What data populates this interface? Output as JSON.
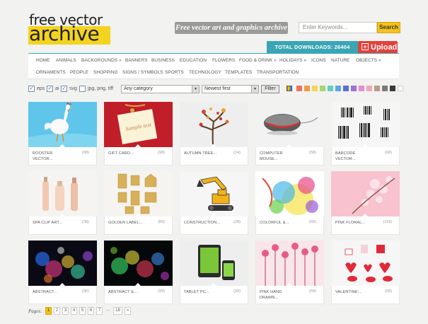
{
  "header": {
    "logo_line1": "free vector",
    "logo_line2": "archive",
    "tagline": "Free vector art and graphics archive",
    "search": {
      "placeholder": "Enter Keywords...",
      "button": "Search"
    },
    "downloads": "TOTAL DOWNLOADS: 26404",
    "upload": "Upload",
    "upload_plus": "+"
  },
  "nav": {
    "row1": [
      "HOME",
      "ANIMALS",
      "BACKGROUNDS »",
      "BANNERS",
      "BUSINESS",
      "EDUCATION",
      "FLOWERS",
      "FOOD & DRINK »",
      "HOLIDAYS »",
      "ICONS",
      "NATURE",
      "OBJECTS »"
    ],
    "row2": [
      "ORNAMENTS",
      "PEOPLE",
      "SHOPPING",
      "SIGNS / SYMBOLS",
      "SPORTS",
      "TECHNOLOGY",
      "TEMPLATES",
      "TRANSPORTATION"
    ]
  },
  "filters": {
    "formats": [
      {
        "label": "eps",
        "checked": true
      },
      {
        "label": "ai",
        "checked": true
      },
      {
        "label": "svg",
        "checked": true
      },
      {
        "label": "jpg, png, tiff",
        "checked": false
      }
    ],
    "category": "Any category",
    "sort": "Newest first",
    "filter_button": "Filter",
    "colors": [
      "#e8735f",
      "#f19a4a",
      "#f5d55a",
      "#a6d66a",
      "#5fd0c5",
      "#5ea7de",
      "#5a6fd1",
      "#9a74cf",
      "#e58ec9",
      "#f0a8b8",
      "#b89b88",
      "#7b7b7b",
      "#3a3a3a",
      "#ffffff"
    ]
  },
  "cards": [
    {
      "title": "ROOSTER VECTOR...",
      "count": "(98)"
    },
    {
      "title": "GIFT CARD...",
      "count": "(98)"
    },
    {
      "title": "AUTUMN TREE...",
      "count": "(14)"
    },
    {
      "title": "COMPUTER MOUSE...",
      "count": "(58)"
    },
    {
      "title": "BARCODE VECTOR...",
      "count": "(68)"
    },
    {
      "title": "SPA CLIP ART...",
      "count": "(38)"
    },
    {
      "title": "GOLDEN LABEL...",
      "count": "(89)"
    },
    {
      "title": "CONSTRUCTION...",
      "count": "(28)"
    },
    {
      "title": "COLORFUL &...",
      "count": "(68)"
    },
    {
      "title": "PINK FLORAL...",
      "count": "(119)"
    },
    {
      "title": "ABSTRACT...",
      "count": "(96)"
    },
    {
      "title": "ABSTRACT &...",
      "count": "(99)"
    },
    {
      "title": "TABLET PC...",
      "count": "(99)"
    },
    {
      "title": "PINK HAND DRAWN...",
      "count": "(58)"
    },
    {
      "title": "VALENTINE'...",
      "count": "(68)"
    }
  ],
  "card_image_text": {
    "sample_text": "Sample text"
  },
  "pager": {
    "label": "Pages:",
    "pages": [
      "1",
      "2",
      "3",
      "4",
      "5",
      "6",
      "7",
      "...",
      "18",
      "»"
    ],
    "active": "1"
  }
}
